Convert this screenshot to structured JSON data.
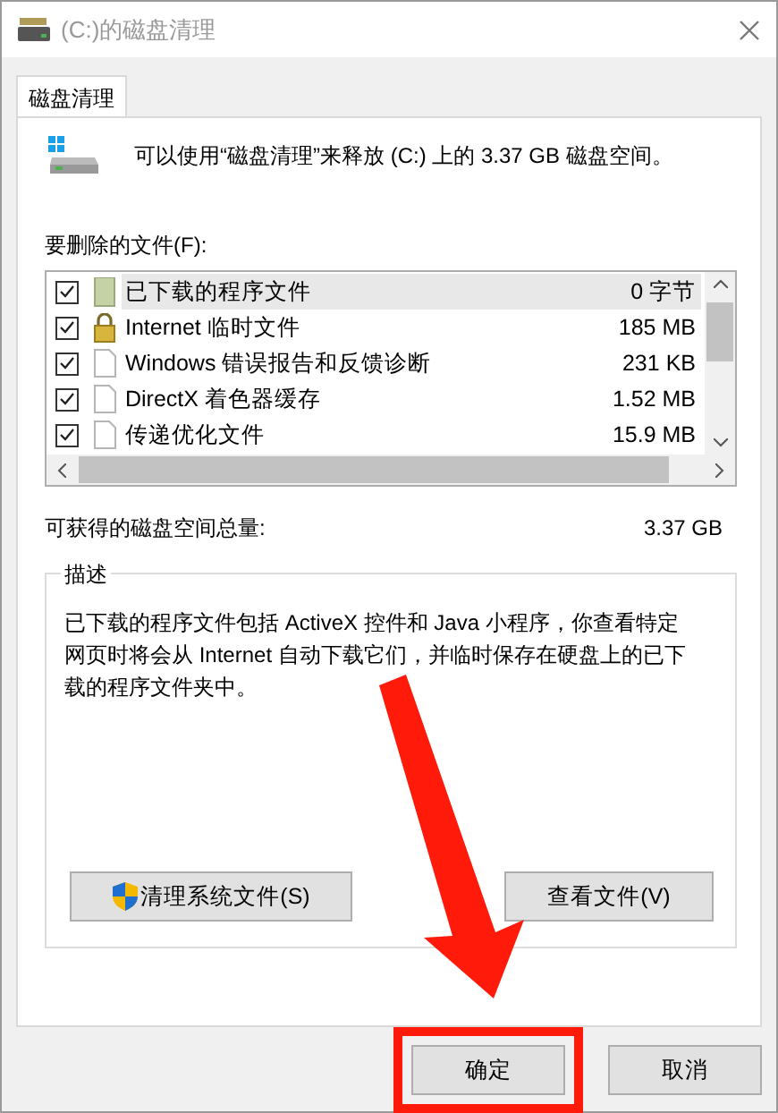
{
  "window": {
    "title": "(C:)的磁盘清理"
  },
  "tabs": [
    {
      "label": "磁盘清理",
      "selected": true
    }
  ],
  "intro": "可以使用“磁盘清理”来释放 (C:) 上的 3.37 GB 磁盘空间。",
  "files_label": "要删除的文件(F):",
  "files": [
    {
      "name": "已下载的程序文件",
      "size": "0 字节",
      "checked": true,
      "selected": true,
      "kind": "folder"
    },
    {
      "name": "Internet 临时文件",
      "size": "185 MB",
      "checked": true,
      "selected": false,
      "kind": "lock"
    },
    {
      "name": "Windows 错误报告和反馈诊断",
      "size": "231 KB",
      "checked": true,
      "selected": false,
      "kind": "file"
    },
    {
      "name": "DirectX 着色器缓存",
      "size": "1.52 MB",
      "checked": true,
      "selected": false,
      "kind": "file"
    },
    {
      "name": "传递优化文件",
      "size": "15.9 MB",
      "checked": true,
      "selected": false,
      "kind": "file"
    }
  ],
  "total": {
    "label": "可获得的磁盘空间总量:",
    "value": "3.37 GB"
  },
  "description": {
    "title": "描述",
    "text": "已下载的程序文件包括 ActiveX 控件和 Java 小程序，你查看特定网页时将会从 Internet 自动下载它们，并临时保存在硬盘上的已下载的程序文件夹中。"
  },
  "buttons": [
    {
      "label": "清理系统文件(S)",
      "kind": "shield"
    },
    {
      "label": "查看文件(V)",
      "kind": "plain"
    }
  ],
  "footer_buttons": [
    {
      "label": "确定",
      "highlighted": true
    },
    {
      "label": "取消",
      "highlighted": false
    }
  ]
}
